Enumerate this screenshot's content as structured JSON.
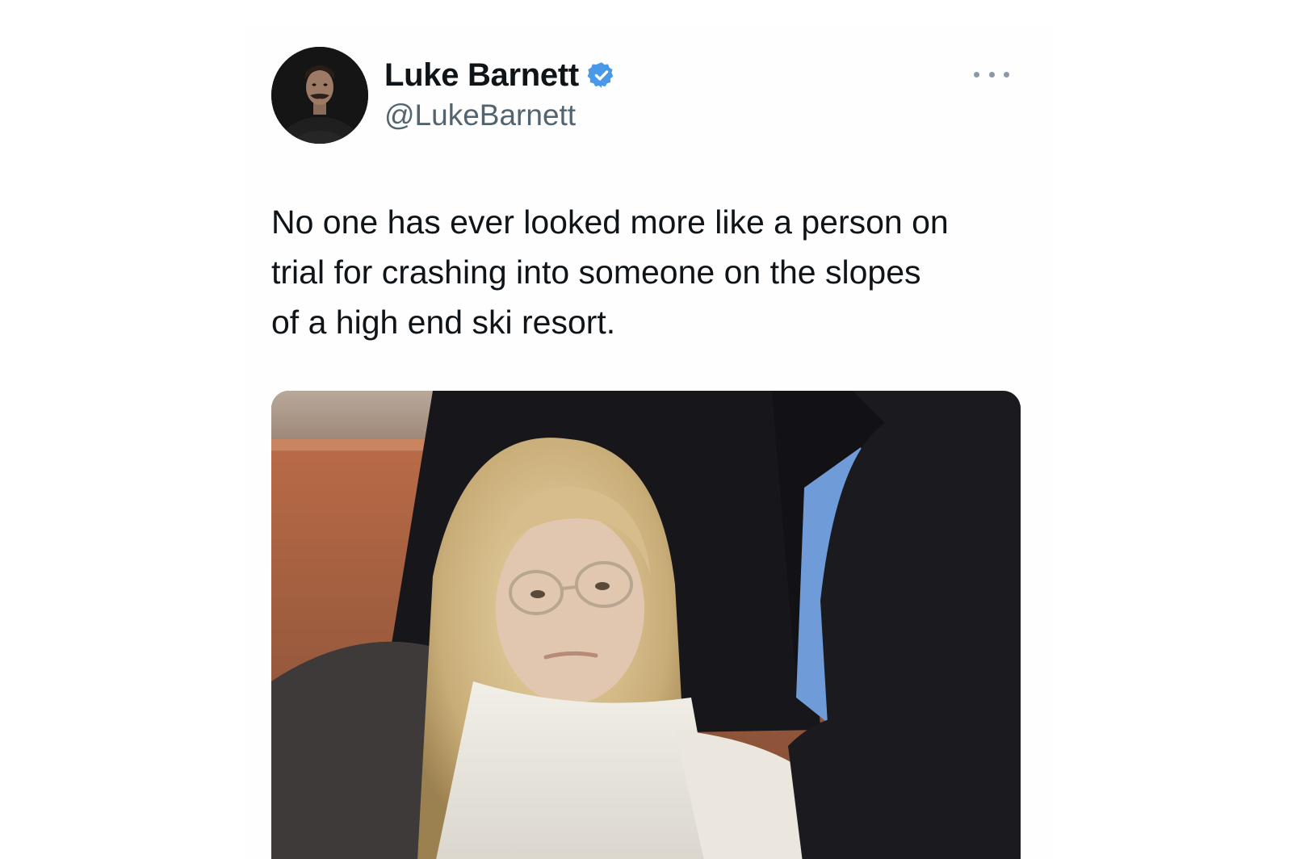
{
  "tweet": {
    "author": {
      "display_name": "Luke Barnett",
      "handle": "@LukeBarnett",
      "verified": true,
      "verified_color": "#4a99e9"
    },
    "text": "No one has ever looked more like a person on\ntrial for crashing into someone on the slopes\nof a high end ski resort.",
    "more_icon": "more-horizontal-icon"
  }
}
